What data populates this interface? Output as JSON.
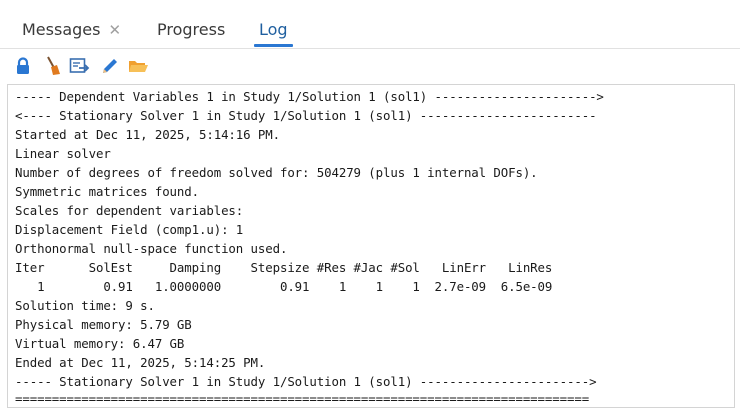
{
  "tabs": [
    {
      "label": "Messages",
      "close_symbol": "✕",
      "active": false
    },
    {
      "label": "Progress",
      "active": false
    },
    {
      "label": "Log",
      "active": true
    }
  ],
  "toolbar": {
    "icons": [
      "lock-icon",
      "broom-icon",
      "export-icon",
      "pencil-icon",
      "folder-icon"
    ],
    "colors": {
      "lock": "#2a77d2",
      "broom": "#e07a1f",
      "export": "#3a6fb0",
      "pencil": "#2a77d2",
      "folder": "#f0a030"
    }
  },
  "log": {
    "lines": [
      "----- Dependent Variables 1 in Study 1/Solution 1 (sol1) ---------------------->",
      "<---- Stationary Solver 1 in Study 1/Solution 1 (sol1) ------------------------",
      "Started at Dec 11, 2025, 5:14:16 PM.",
      "Linear solver",
      "Number of degrees of freedom solved for: 504279 (plus 1 internal DOFs).",
      "Symmetric matrices found.",
      "Scales for dependent variables:",
      "Displacement Field (comp1.u): 1",
      "Orthonormal null-space function used.",
      "Iter      SolEst     Damping    Stepsize #Res #Jac #Sol   LinErr   LinRes",
      "   1        0.91   1.0000000        0.91    1    1    1  2.7e-09  6.5e-09",
      "Solution time: 9 s.",
      "Physical memory: 5.79 GB",
      "Virtual memory: 6.47 GB",
      "Ended at Dec 11, 2025, 5:14:25 PM.",
      "----- Stationary Solver 1 in Study 1/Solution 1 (sol1) ----------------------->",
      "=============================================================================="
    ]
  }
}
